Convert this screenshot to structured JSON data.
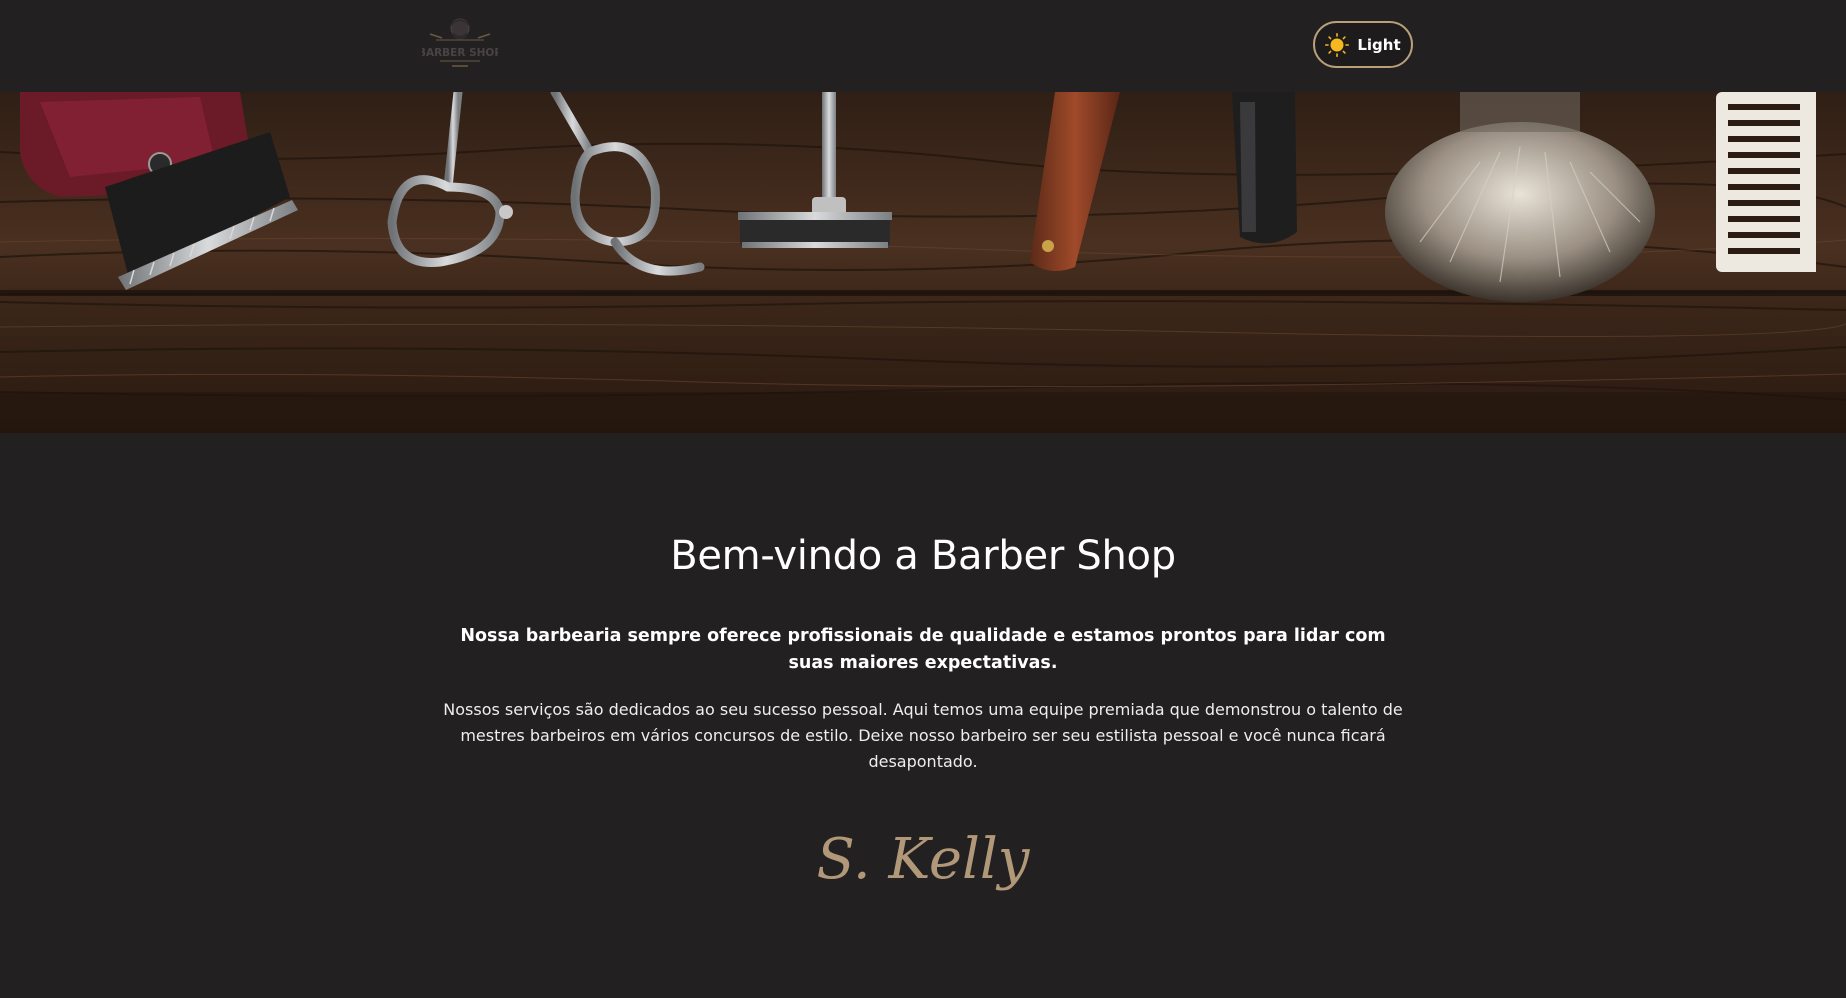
{
  "header": {
    "logo_text": "BARBER SHOP",
    "theme_toggle": {
      "label": "Light",
      "icon": "sun-icon"
    }
  },
  "hero": {
    "image": "barber-tools-on-wood-banner"
  },
  "welcome": {
    "title": "Bem-vindo a Barber Shop",
    "lead": "Nossa barbearia sempre oferece profissionais de qualidade e estamos prontos para lidar com suas maiores expectativas.",
    "body": "Nossos serviços são dedicados ao seu sucesso pessoal. Aqui temos uma equipe premiada que demonstrou o talento de mestres barbeiros em vários concursos de estilo. Deixe nosso barbeiro ser seu estilista pessoal e você nunca ficará desapontado.",
    "signature": "S. Kelly"
  },
  "colors": {
    "background": "#222021",
    "accent": "#b09878",
    "button_border": "#b7a07a",
    "sun": "#f5b820"
  }
}
